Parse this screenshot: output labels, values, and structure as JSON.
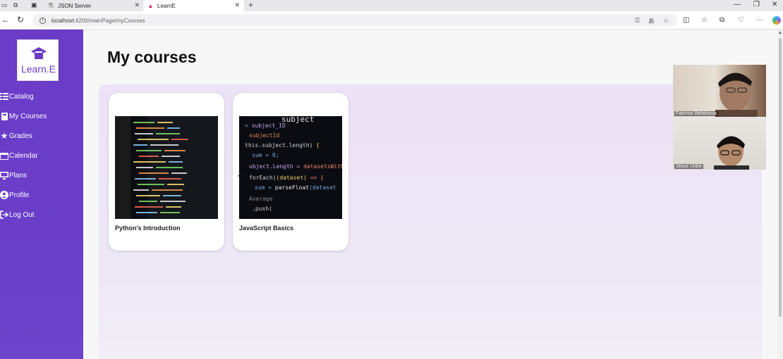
{
  "browser": {
    "tabs": [
      {
        "title": "JSON Server",
        "active": false
      },
      {
        "title": "LearnE",
        "active": true
      }
    ],
    "url_host": "localhost",
    "url_path": ":4200/mainPage/myCourses"
  },
  "sidebar": {
    "logo_text": "Learn.E",
    "items": [
      {
        "label": "Catalog",
        "icon": "list-icon"
      },
      {
        "label": "My Courses",
        "icon": "book-icon"
      },
      {
        "label": "Grades",
        "icon": "star-icon"
      },
      {
        "label": "Calendar",
        "icon": "calendar-icon"
      },
      {
        "label": "Plans",
        "icon": "monitor-icon"
      },
      {
        "label": "Profile",
        "icon": "user-icon"
      },
      {
        "label": "Log Out",
        "icon": "logout-icon"
      }
    ]
  },
  "main": {
    "title": "My courses",
    "courses": [
      {
        "title": "Python's Introduction"
      },
      {
        "title": "JavaScript Basics"
      }
    ]
  },
  "video_call": {
    "participants": [
      {
        "name": "Fabrisio Belahonia"
      },
      {
        "name": "Jesus Uribe"
      }
    ]
  },
  "colors": {
    "accent": "#6b3cc7",
    "content_bg": "#ece3f6"
  }
}
